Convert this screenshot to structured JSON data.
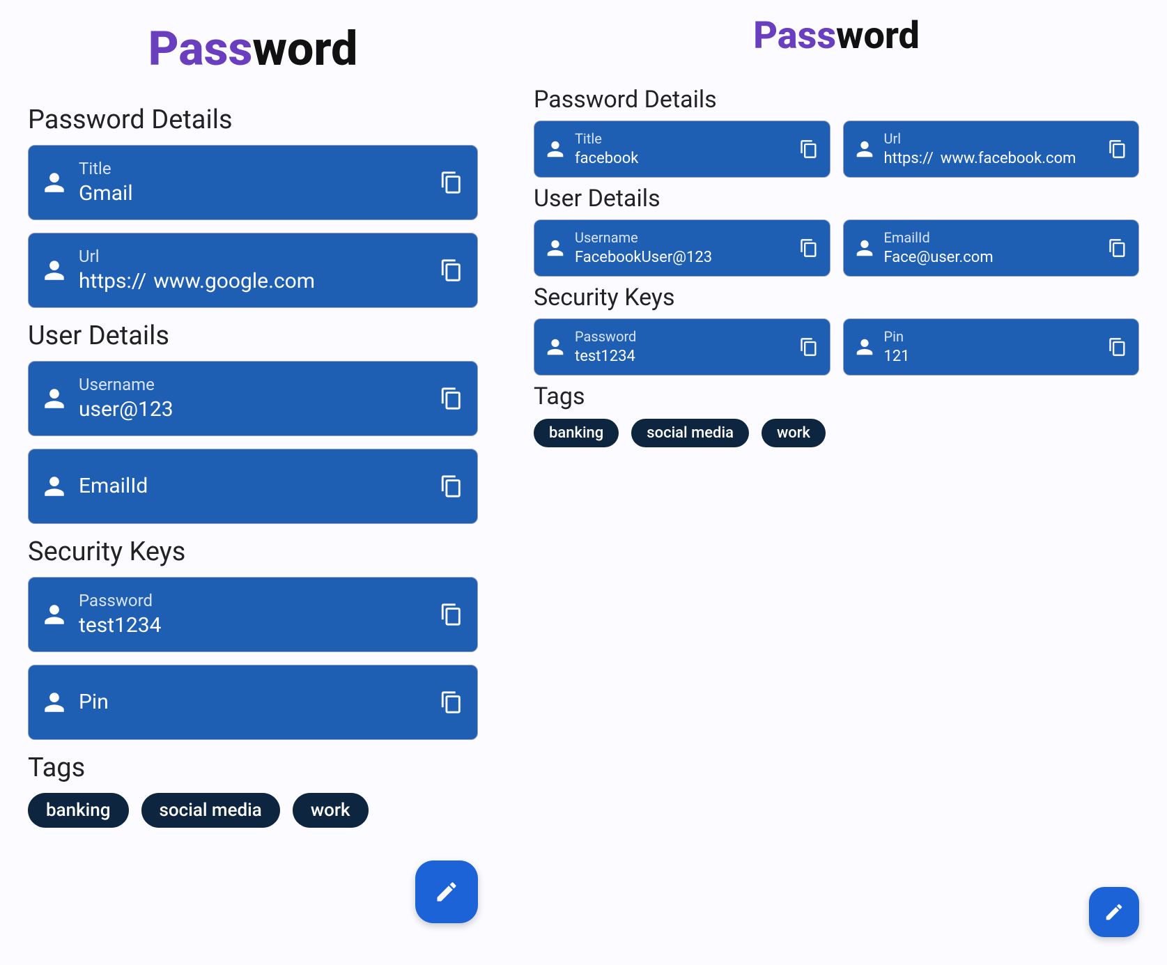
{
  "app_title": {
    "pass": "Pass",
    "word": "word"
  },
  "left": {
    "sections": {
      "password_details": {
        "title": "Password Details"
      },
      "user_details": {
        "title": "User Details"
      },
      "security_keys": {
        "title": "Security Keys"
      },
      "tags_title": "Tags"
    },
    "fields": {
      "title": {
        "label": "Title",
        "value": "Gmail"
      },
      "url": {
        "label": "Url",
        "prefix": "https://",
        "value": "www.google.com"
      },
      "username": {
        "label": "Username",
        "value": "user@123"
      },
      "emailid": {
        "label": "EmailId",
        "value": ""
      },
      "password": {
        "label": "Password",
        "value": "test1234"
      },
      "pin": {
        "label": "Pin",
        "value": ""
      }
    },
    "tags": [
      "banking",
      "social media",
      "work"
    ]
  },
  "right": {
    "sections": {
      "password_details": {
        "title": "Password Details"
      },
      "user_details": {
        "title": "User Details"
      },
      "security_keys": {
        "title": "Security Keys"
      },
      "tags_title": "Tags"
    },
    "fields": {
      "title": {
        "label": "Title",
        "value": "facebook"
      },
      "url": {
        "label": "Url",
        "prefix": "https://",
        "value": "www.facebook.com"
      },
      "username": {
        "label": "Username",
        "value": "FacebookUser@123"
      },
      "emailid": {
        "label": "EmailId",
        "value": "Face@user.com"
      },
      "password": {
        "label": "Password",
        "value": "test1234"
      },
      "pin": {
        "label": "Pin",
        "value": "121"
      }
    },
    "tags": [
      "banking",
      "social media",
      "work"
    ]
  },
  "colors": {
    "card_bg": "#1e5fb4",
    "accent": "#6a3fbf",
    "tag_bg": "#0e2540",
    "fab_bg": "#1d63d8"
  }
}
